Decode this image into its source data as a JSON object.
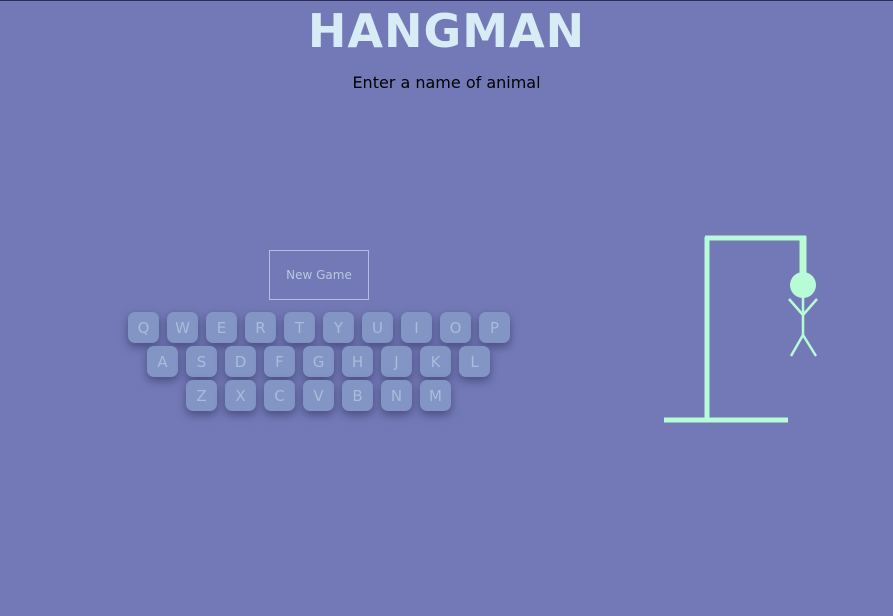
{
  "game": {
    "title": "HANGMAN",
    "prompt": "Enter a name of animal",
    "new_game_label": "New Game"
  },
  "keyboard": {
    "rows": [
      [
        "Q",
        "W",
        "E",
        "R",
        "T",
        "Y",
        "U",
        "I",
        "O",
        "P"
      ],
      [
        "A",
        "S",
        "D",
        "F",
        "G",
        "H",
        "J",
        "K",
        "L"
      ],
      [
        "Z",
        "X",
        "C",
        "V",
        "B",
        "N",
        "M"
      ]
    ]
  },
  "hangman": {
    "color": "#b6fcd5",
    "parts_shown": [
      "base",
      "pole",
      "beam",
      "rope",
      "head",
      "body",
      "left-arm",
      "right-arm",
      "left-leg",
      "right-leg"
    ]
  },
  "colors": {
    "background": "#7379b6",
    "title": "#d8ecf6",
    "key_background": "#8295c4",
    "key_text": "#a8bcdc"
  }
}
